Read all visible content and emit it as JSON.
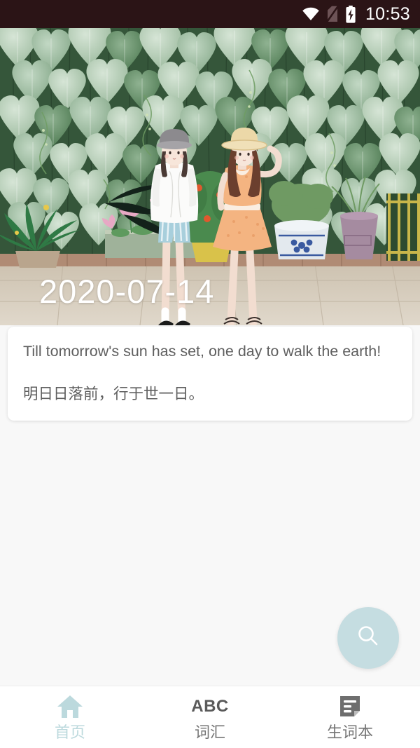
{
  "status_bar": {
    "time": "10:53",
    "icons": [
      "wifi-icon",
      "sim-card-off-icon",
      "battery-charging-icon"
    ],
    "background_color": "#2b1416"
  },
  "hero": {
    "date": "2020-07-14",
    "illustration_alt": "Illustration of two girls standing in front of a wall of heart-shaped green vine leaves with potted plants",
    "colors": {
      "leaf_light": "#b8cfbc",
      "leaf_mid": "#8fb391",
      "leaf_dark": "#3f6b45",
      "wall_dark": "#2e4d33",
      "pavement": "#d9cfc0",
      "brick": "#b08b74",
      "dress_orange": "#f0b183",
      "shorts_blue": "#9cc4d4",
      "pot_blue": "#dde4e8",
      "pot_mauve": "#a58ba0",
      "fence_yellow": "#c8b64a",
      "flower_pink": "#e7a8c4"
    }
  },
  "quote_card": {
    "english": "Till tomorrow's sun has set, one day to walk the earth!",
    "chinese": "明日日落前，行于世一日。",
    "text_color": "#5f5f5f",
    "background_color": "#ffffff"
  },
  "fab": {
    "icon": "search-icon",
    "color": "#c5dde1",
    "icon_color": "#ffffff"
  },
  "bottom_nav": {
    "items": [
      {
        "label": "首页",
        "icon": "home-icon",
        "active": true,
        "color": "#bcd9dd"
      },
      {
        "label": "词汇",
        "icon": "abc-icon",
        "active": false,
        "color": "#757575"
      },
      {
        "label": "生词本",
        "icon": "note-icon",
        "active": false,
        "color": "#757575"
      }
    ]
  }
}
